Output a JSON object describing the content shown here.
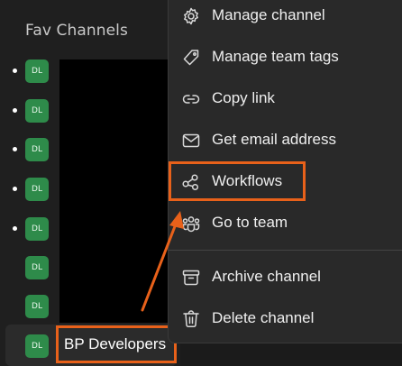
{
  "sidebar": {
    "section_title": "Fav Channels",
    "channels": [
      {
        "initials": "DL"
      },
      {
        "initials": "DL"
      },
      {
        "initials": "DL"
      },
      {
        "initials": "DL"
      },
      {
        "initials": "DL"
      },
      {
        "initials": "DL"
      },
      {
        "initials": "DL"
      }
    ],
    "selected_channel": {
      "initials": "DL",
      "name": "BP Developers"
    }
  },
  "context_menu": {
    "items": [
      {
        "label": "Manage channel",
        "icon": "gear-icon"
      },
      {
        "label": "Manage team tags",
        "icon": "tag-icon"
      },
      {
        "label": "Copy link",
        "icon": "link-icon"
      },
      {
        "label": "Get email address",
        "icon": "mail-icon"
      },
      {
        "label": "Workflows",
        "icon": "workflow-icon"
      },
      {
        "label": "Go to team",
        "icon": "team-icon"
      },
      {
        "label": "Archive channel",
        "icon": "archive-icon"
      },
      {
        "label": "Delete channel",
        "icon": "trash-icon"
      }
    ]
  },
  "colors": {
    "annotation": "#e8611a",
    "avatar_green": "#2e8b4a",
    "menu_bg": "#292929"
  }
}
